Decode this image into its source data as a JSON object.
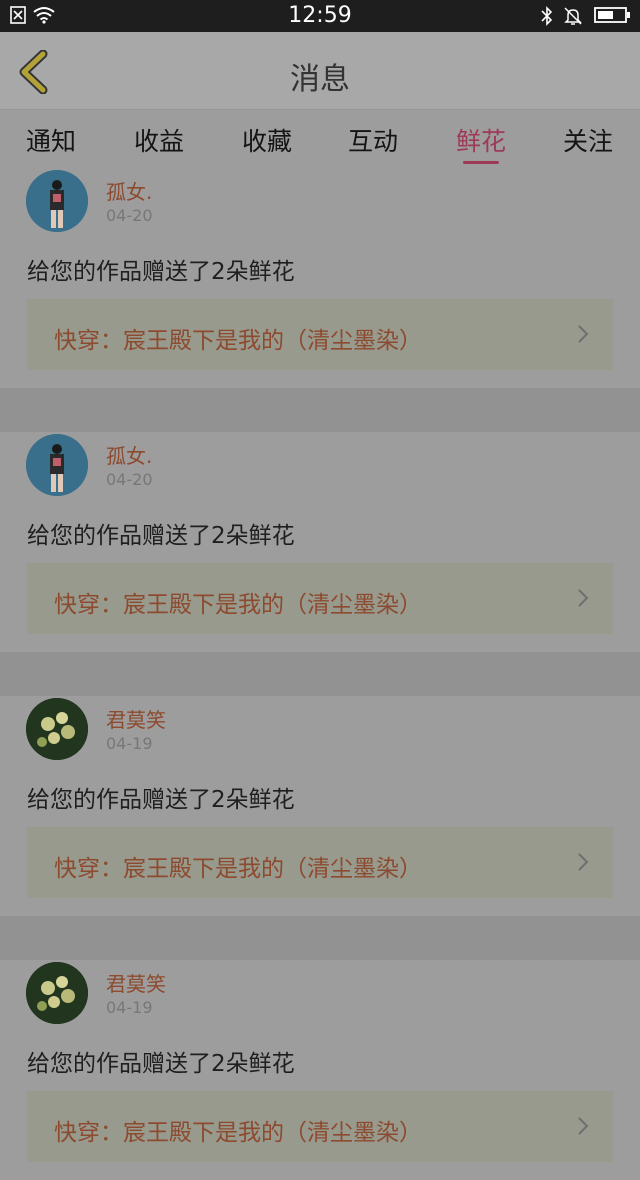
{
  "status_bar": {
    "time": "12:59"
  },
  "header": {
    "title": "消息"
  },
  "tabs": [
    {
      "label": "通知"
    },
    {
      "label": "收益"
    },
    {
      "label": "收藏"
    },
    {
      "label": "互动"
    },
    {
      "label": "鲜花"
    },
    {
      "label": "关注"
    }
  ],
  "active_tab": "鲜花",
  "messages": [
    {
      "name": "孤女.",
      "date": "04-20",
      "text": "给您的作品赠送了2朵鲜花",
      "work": "快穿：宸王殿下是我的（清尘墨染）"
    },
    {
      "name": "孤女.",
      "date": "04-20",
      "text": "给您的作品赠送了2朵鲜花",
      "work": "快穿：宸王殿下是我的（清尘墨染）"
    },
    {
      "name": "君莫笑",
      "date": "04-19",
      "text": "给您的作品赠送了2朵鲜花",
      "work": "快穿：宸王殿下是我的（清尘墨染）"
    },
    {
      "name": "君莫笑",
      "date": "04-19",
      "text": "给您的作品赠送了2朵鲜花",
      "work": "快穿：宸王殿下是我的（清尘墨染）"
    }
  ],
  "colors": {
    "accent": "#9c3a57",
    "name_color": "#8d4a2e"
  }
}
